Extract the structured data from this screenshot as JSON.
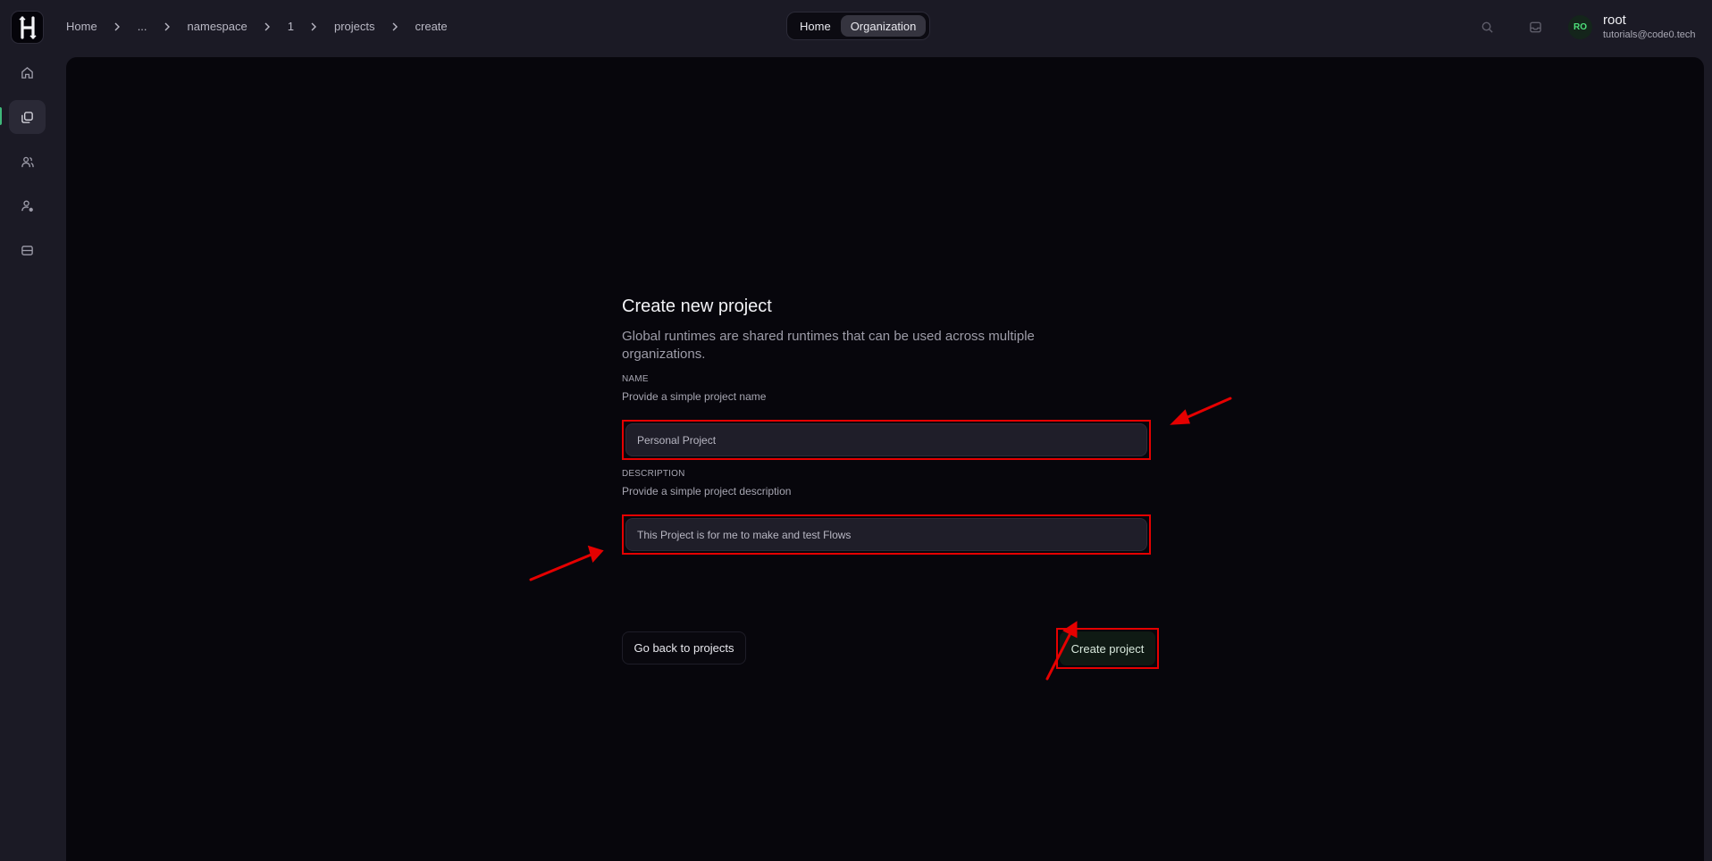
{
  "breadcrumb": {
    "items": [
      "Home",
      "...",
      "namespace",
      "1",
      "projects",
      "create"
    ]
  },
  "header": {
    "toggle_home": "Home",
    "toggle_organization": "Organization",
    "user_initials": "RO",
    "user_name": "root",
    "user_email": "tutorials@code0.tech"
  },
  "sidebar": {
    "icons": [
      "home-icon",
      "projects-icon",
      "members-icon",
      "user-settings-icon",
      "runtimes-icon"
    ],
    "active_index": 1
  },
  "form": {
    "title": "Create new project",
    "subtitle": "Global runtimes are shared runtimes that can be used across multiple organizations.",
    "name_label": "NAME",
    "name_help": "Provide a simple project name",
    "name_value": "Personal Project",
    "description_label": "DESCRIPTION",
    "description_help": "Provide a simple project description",
    "description_value": "This Project is for me to make and test Flows",
    "back_button": "Go back to projects",
    "create_button": "Create project"
  },
  "colors": {
    "annotation": "#e50000",
    "accent": "#3fb87a"
  }
}
